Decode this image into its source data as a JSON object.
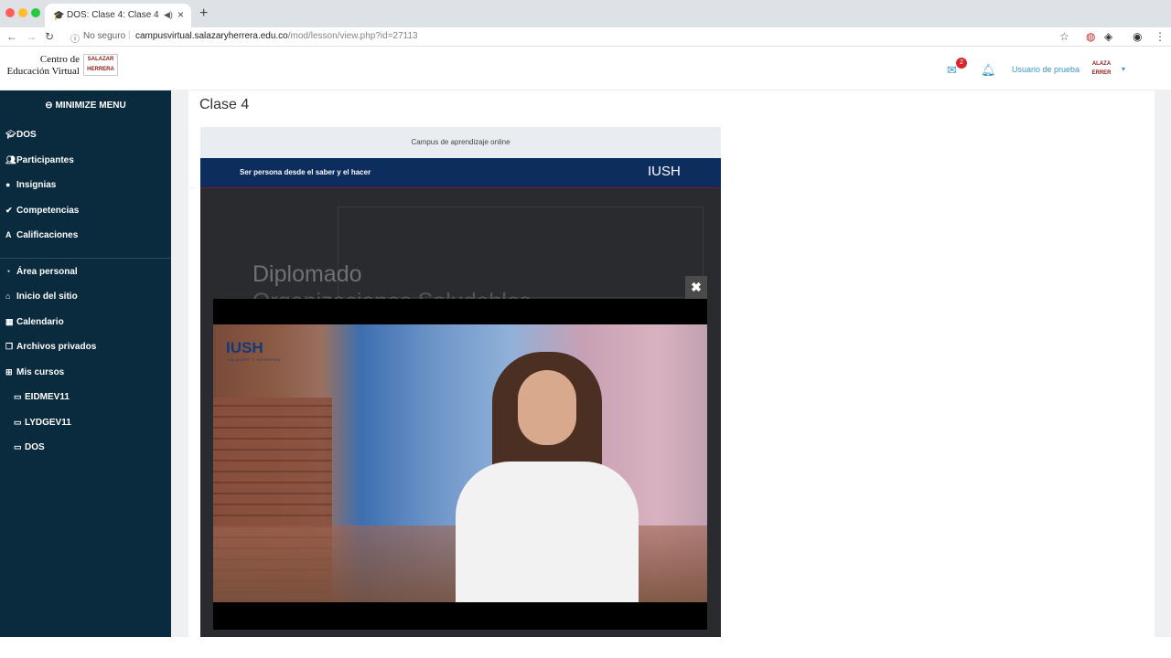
{
  "browser": {
    "tab_title": "DOS: Clase 4: Clase 4",
    "tab_favicon": "🎓",
    "url_security": "No seguro",
    "url_host": "campusvirtual.salazaryherrera.edu.co",
    "url_path": "/mod/lesson/view.php?id=27113"
  },
  "header": {
    "logo_line1": "Centro de",
    "logo_line2": "Educación Virtual",
    "logo_badge_line1": "SALAZAR",
    "logo_badge_line2": "HERRERA",
    "message_count": "2",
    "username": "Usuario de prueba",
    "avatar_line1": "ALAZA",
    "avatar_line2": "ERRER"
  },
  "sidebar": {
    "minimize_label": "MINIMIZE MENU",
    "items": [
      {
        "label": "DOS",
        "icon": "graduation-cap-icon"
      },
      {
        "label": "Participantes",
        "icon": "users-icon"
      },
      {
        "label": "Insignias",
        "icon": "badge-icon"
      },
      {
        "label": "Competencias",
        "icon": "check-circle-icon"
      },
      {
        "label": "Calificaciones",
        "icon": "grades-icon"
      },
      {
        "label": "Área personal",
        "icon": "dashboard-icon"
      },
      {
        "label": "Inicio del sitio",
        "icon": "home-icon"
      },
      {
        "label": "Calendario",
        "icon": "calendar-icon"
      },
      {
        "label": "Archivos privados",
        "icon": "files-icon"
      },
      {
        "label": "Mis cursos",
        "icon": "sitemap-icon"
      },
      {
        "label": "EIDMEV11",
        "icon": "folder-icon"
      },
      {
        "label": "LYDGEV11",
        "icon": "folder-icon"
      },
      {
        "label": "DOS",
        "icon": "folder-icon"
      }
    ]
  },
  "main": {
    "page_title": "Clase 4",
    "campus_label": "Campus de aprendizaje online",
    "motto": "Ser persona desde el saber y el hacer",
    "brand": "IUSH",
    "bg_title_line1": "Diplomado",
    "bg_title_line2": "Organizaciones Saludables",
    "video_logo": "IUSH",
    "video_logo_sub": "SALAZAR Y HERRERA"
  },
  "colors": {
    "sidebar_bg": "#0a2a3e",
    "link_blue": "#3a98c9",
    "brand_navy": "#0c2d5e"
  }
}
